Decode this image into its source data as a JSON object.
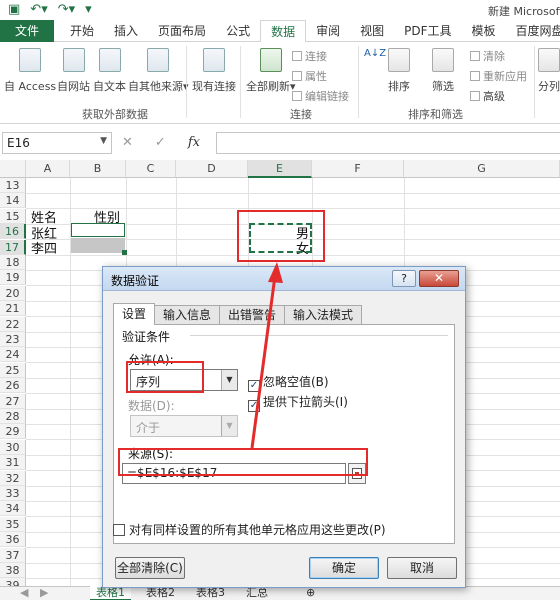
{
  "app": {
    "title": "新建 Microsoft"
  },
  "ribbon": {
    "tabs": [
      "文件",
      "开始",
      "插入",
      "页面布局",
      "公式",
      "数据",
      "审阅",
      "视图",
      "PDF工具",
      "模板",
      "百度网盘"
    ],
    "active_tab": "数据",
    "get_external": {
      "buttons": [
        "自 Access",
        "自网站",
        "自文本",
        "自其他来源",
        "现有连接"
      ],
      "label": "获取外部数据"
    },
    "connections": {
      "refresh_label": "全部刷新",
      "small": [
        "连接",
        "属性",
        "编辑链接"
      ],
      "label": "连接"
    },
    "sort_filter": {
      "sort_az": "A↓Z",
      "sort_label": "排序",
      "filter_label": "筛选",
      "small": [
        "清除",
        "重新应用",
        "高级"
      ],
      "label": "排序和筛选",
      "split_label": "分列"
    }
  },
  "formula_bar": {
    "name_box": "E16",
    "fx": "fx",
    "cancel": "✕",
    "enter": "✓"
  },
  "grid": {
    "columns": [
      "A",
      "B",
      "C",
      "D",
      "E",
      "F",
      "G"
    ],
    "rows": [
      "13",
      "14",
      "15",
      "16",
      "17",
      "18",
      "19",
      "20",
      "21",
      "22",
      "23",
      "24",
      "25",
      "26",
      "27",
      "28",
      "29",
      "30",
      "31",
      "32",
      "33",
      "34",
      "35",
      "36",
      "37",
      "38",
      "39"
    ],
    "cells": {
      "a15": "姓名",
      "b15": "性别",
      "a16": "张红",
      "a17": "李四",
      "e16": "男",
      "e17": "女"
    }
  },
  "sheets": [
    "表格1",
    "表格2",
    "表格3",
    "汇总"
  ],
  "dialog": {
    "title": "数据验证",
    "help": "?",
    "close": "✕",
    "tabs": [
      "设置",
      "输入信息",
      "出错警告",
      "输入法模式"
    ],
    "active_tab": "设置",
    "criteria_label": "验证条件",
    "allow_label": "允许(A):",
    "allow_value": "序列",
    "ignore_blank": {
      "label": "忽略空值(B)",
      "checked": true
    },
    "in_cell_dropdown": {
      "label": "提供下拉箭头(I)",
      "checked": true
    },
    "data_label": "数据(D):",
    "data_value": "介于",
    "source_label": "来源(S):",
    "source_value": "=$E$16:$E$17",
    "apply_all": {
      "label": "对有同样设置的所有其他单元格应用这些更改(P)",
      "checked": false
    },
    "clear_all": "全部清除(C)",
    "ok": "确定",
    "cancel": "取消"
  },
  "colors": {
    "excel_green": "#217346",
    "annotation_red": "#e32b2b"
  }
}
